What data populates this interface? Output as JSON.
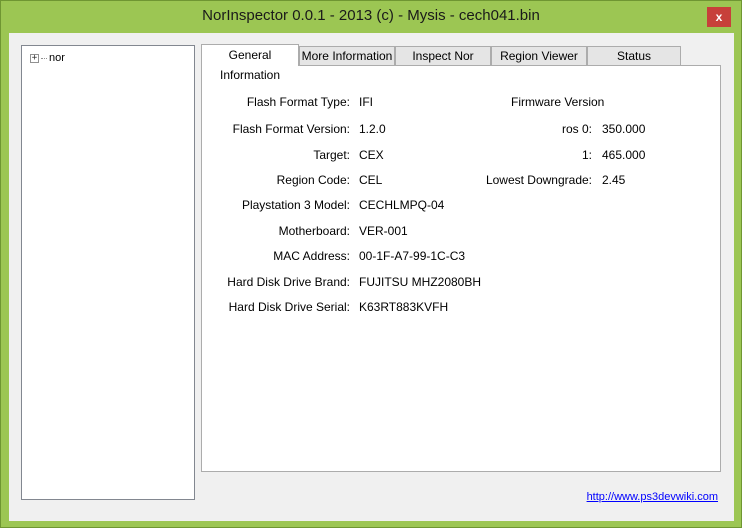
{
  "window": {
    "title": "NorInspector 0.0.1 - 2013 (c) - Mysis - cech041.bin",
    "close_icon": "close-icon",
    "close_glyph": "x"
  },
  "tree": {
    "expander_glyph": "+",
    "root_label": "nor"
  },
  "tabs": [
    {
      "label": "General Information",
      "active": true
    },
    {
      "label": "More Information",
      "active": false
    },
    {
      "label": "Inspect Nor",
      "active": false
    },
    {
      "label": "Region Viewer",
      "active": false
    },
    {
      "label": "Status",
      "active": false
    }
  ],
  "general": {
    "flash_format_type": {
      "label": "Flash Format Type:",
      "value": "IFI"
    },
    "flash_format_version": {
      "label": "Flash Format Version:",
      "value": "1.2.0"
    },
    "target": {
      "label": "Target:",
      "value": "CEX"
    },
    "region_code": {
      "label": "Region Code:",
      "value": "CEL"
    },
    "ps3_model": {
      "label": "Playstation 3 Model:",
      "value": "CECHLMPQ-04"
    },
    "motherboard": {
      "label": "Motherboard:",
      "value": "VER-001"
    },
    "mac_address": {
      "label": "MAC Address:",
      "value": "00-1F-A7-99-1C-C3"
    },
    "hdd_brand": {
      "label": "Hard Disk Drive Brand:",
      "value": "FUJITSU MHZ2080BH"
    },
    "hdd_serial": {
      "label": "Hard Disk Drive Serial:",
      "value": "K63RT883KVFH"
    }
  },
  "firmware": {
    "heading": "Firmware Version",
    "ros0": {
      "label": "ros 0:",
      "value": "350.000"
    },
    "ros1": {
      "label": "1:",
      "value": "465.000"
    },
    "lowest_downgrade": {
      "label": "Lowest Downgrade:",
      "value": "2.45"
    }
  },
  "footer": {
    "link": "http://www.ps3devwiki.com"
  }
}
